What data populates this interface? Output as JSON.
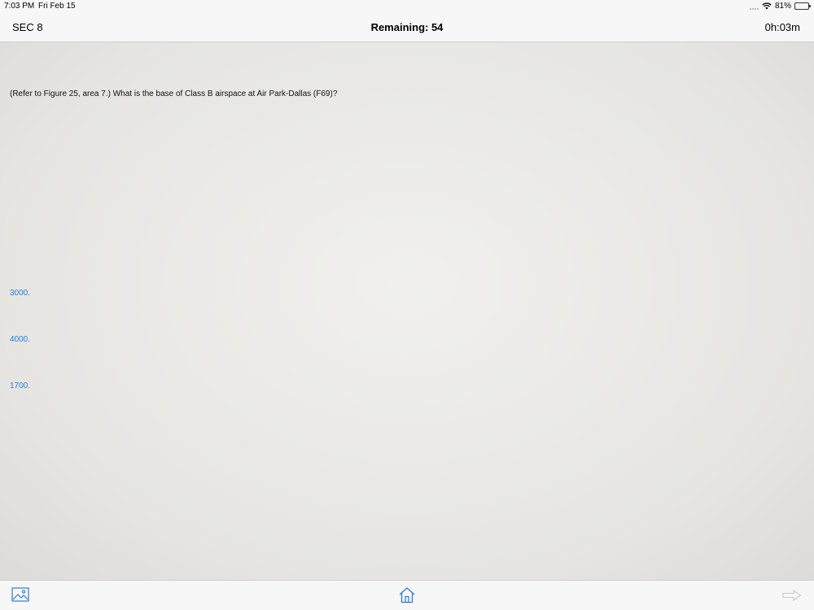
{
  "status": {
    "time": "7:03 PM",
    "date": "Fri Feb 15",
    "battery": "81%",
    "battery_level": 0.81
  },
  "nav": {
    "section": "SEC 8",
    "remaining": "Remaining: 54",
    "timer": "0h:03m"
  },
  "question": {
    "text": "(Refer to Figure 25, area 7.) What is the base of Class B airspace at Air Park-Dallas (F69)?"
  },
  "answers": [
    "3000.",
    "4000.",
    "1700."
  ],
  "toolbar": {
    "figure_icon": "image-icon",
    "home_icon": "home-icon",
    "next_icon": "arrow-right-icon"
  },
  "colors": {
    "accent": "#2a7de1",
    "background": "#e9e8e5"
  }
}
